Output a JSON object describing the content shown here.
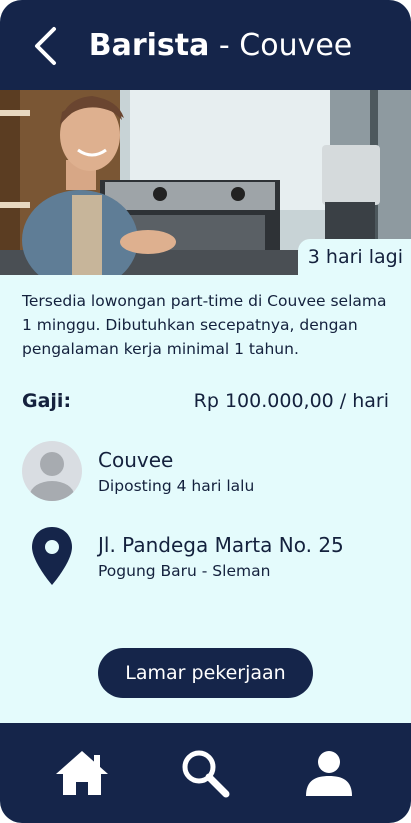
{
  "header": {
    "job_title": "Barista",
    "separator": " - ",
    "company": "Couvee",
    "back_icon": "chevron-left-icon"
  },
  "hero": {
    "badge": "3 hari lagi"
  },
  "description": "Tersedia lowongan part-time di Couvee selama 1 minggu. Dibutuhkan secepatnya, dengan pengalaman kerja minimal 1 tahun.",
  "salary": {
    "label": "Gaji:",
    "value": "Rp 100.000,00 / hari"
  },
  "poster": {
    "name": "Couvee",
    "posted": "Diposting 4 hari lalu",
    "avatar_icon": "user-avatar-icon"
  },
  "location": {
    "address": "Jl. Pandega Marta No. 25",
    "area": "Pogung Baru - Sleman",
    "icon": "location-pin-icon"
  },
  "apply_button": "Lamar pekerjaan",
  "bottom_nav": [
    {
      "icon": "home-icon"
    },
    {
      "icon": "search-icon"
    },
    {
      "icon": "user-icon"
    }
  ],
  "colors": {
    "primary": "#15254a",
    "background": "#e4fbfc",
    "text": "#14213d",
    "on_primary": "#ffffff"
  }
}
